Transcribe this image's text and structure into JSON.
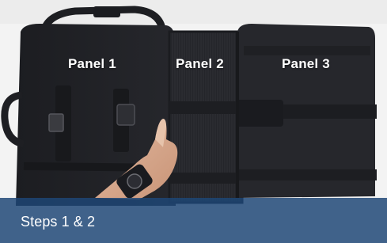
{
  "panels": [
    {
      "label": "Panel 1"
    },
    {
      "label": "Panel 2"
    },
    {
      "label": "Panel 3"
    }
  ],
  "caption": "Steps 1 & 2",
  "colors": {
    "bag": "#232428",
    "background": "#f2f2f2",
    "caption_bar": "#1e4676",
    "label_text": "#ffffff"
  },
  "photo_description_icons": [
    "handle-icon",
    "buckle-icon",
    "wristwatch-icon"
  ]
}
